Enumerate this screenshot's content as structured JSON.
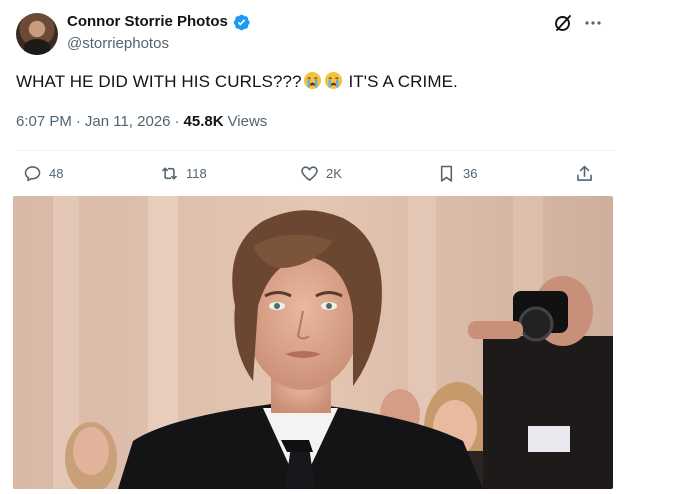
{
  "author": {
    "display_name": "Connor Storrie Photos",
    "handle": "@storriephotos",
    "verified_icon": "verified-badge-icon",
    "avatar_icon": "avatar"
  },
  "post": {
    "text_before": "WHAT HE DID WITH HIS CURLS???",
    "emojis": [
      "loudly-crying-face",
      "loudly-crying-face"
    ],
    "text_after": " IT'S A CRIME.",
    "time": "6:07 PM",
    "separator_1": "·",
    "date": "Jan 11, 2026",
    "separator_2": "·",
    "views_count": "45.8K",
    "views_label": "Views"
  },
  "actions": {
    "replies": "48",
    "reposts": "118",
    "likes": "2K",
    "bookmarks": "36"
  },
  "icons": {
    "grok": "grok-icon",
    "more": "more-icon",
    "reply": "reply-icon",
    "repost": "repost-icon",
    "like": "heart-icon",
    "bookmark": "bookmark-icon",
    "share": "share-icon"
  },
  "colors": {
    "text": "#0f1419",
    "secondary": "#536471",
    "verified": "#1d9bf0",
    "divider": "#eff3f4"
  }
}
